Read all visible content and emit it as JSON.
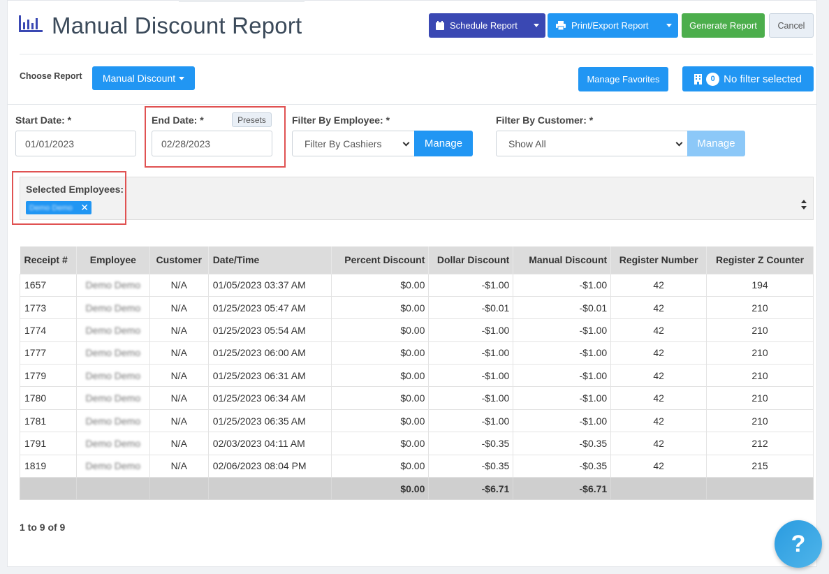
{
  "header": {
    "title": "Manual Discount Report",
    "schedule_label": "Schedule Report",
    "print_label": "Print/Export Report",
    "generate_label": "Generate Report",
    "cancel_label": "Cancel"
  },
  "report_bar": {
    "choose_label": "Choose Report",
    "report_select": "Manual Discount",
    "favorites_label": "Manage Favorites",
    "filter_count": "0",
    "filter_label": "No filter selected"
  },
  "filters": {
    "start_label": "Start Date: *",
    "start_value": "01/01/2023",
    "end_label": "End Date: *",
    "end_value": "02/28/2023",
    "presets_label": "Presets",
    "employee_label": "Filter By Employee: *",
    "employee_value": "Filter By Cashiers",
    "customer_label": "Filter By Customer: *",
    "customer_value": "Show All",
    "manage_label": "Manage"
  },
  "selected": {
    "label": "Selected Employees:",
    "chip": "Demo Demo"
  },
  "table": {
    "headers": [
      "Receipt #",
      "Employee",
      "Customer",
      "Date/Time",
      "Percent Discount",
      "Dollar Discount",
      "Manual Discount",
      "Register Number",
      "Register Z Counter"
    ],
    "rows": [
      [
        "1657",
        "Demo Demo",
        "N/A",
        "01/05/2023 03:37 AM",
        "$0.00",
        "-$1.00",
        "-$1.00",
        "42",
        "194"
      ],
      [
        "1773",
        "Demo Demo",
        "N/A",
        "01/25/2023 05:47 AM",
        "$0.00",
        "-$0.01",
        "-$0.01",
        "42",
        "210"
      ],
      [
        "1774",
        "Demo Demo",
        "N/A",
        "01/25/2023 05:54 AM",
        "$0.00",
        "-$1.00",
        "-$1.00",
        "42",
        "210"
      ],
      [
        "1777",
        "Demo Demo",
        "N/A",
        "01/25/2023 06:00 AM",
        "$0.00",
        "-$1.00",
        "-$1.00",
        "42",
        "210"
      ],
      [
        "1779",
        "Demo Demo",
        "N/A",
        "01/25/2023 06:31 AM",
        "$0.00",
        "-$1.00",
        "-$1.00",
        "42",
        "210"
      ],
      [
        "1780",
        "Demo Demo",
        "N/A",
        "01/25/2023 06:34 AM",
        "$0.00",
        "-$1.00",
        "-$1.00",
        "42",
        "210"
      ],
      [
        "1781",
        "Demo Demo",
        "N/A",
        "01/25/2023 06:35 AM",
        "$0.00",
        "-$1.00",
        "-$1.00",
        "42",
        "210"
      ],
      [
        "1791",
        "Demo Demo",
        "N/A",
        "02/03/2023 04:11 AM",
        "$0.00",
        "-$0.35",
        "-$0.35",
        "42",
        "212"
      ],
      [
        "1819",
        "Demo Demo",
        "N/A",
        "02/06/2023 08:04 PM",
        "$0.00",
        "-$0.35",
        "-$0.35",
        "42",
        "215"
      ]
    ],
    "totals": [
      "",
      "",
      "",
      "",
      "$0.00",
      "-$6.71",
      "-$6.71",
      "",
      ""
    ]
  },
  "pager": "1 to 9 of 9",
  "help_label": "?",
  "colors": {
    "schedule": "#3a48b3",
    "primary": "#2196f3",
    "generate": "#4cae4c",
    "highlight": "#e05252"
  }
}
